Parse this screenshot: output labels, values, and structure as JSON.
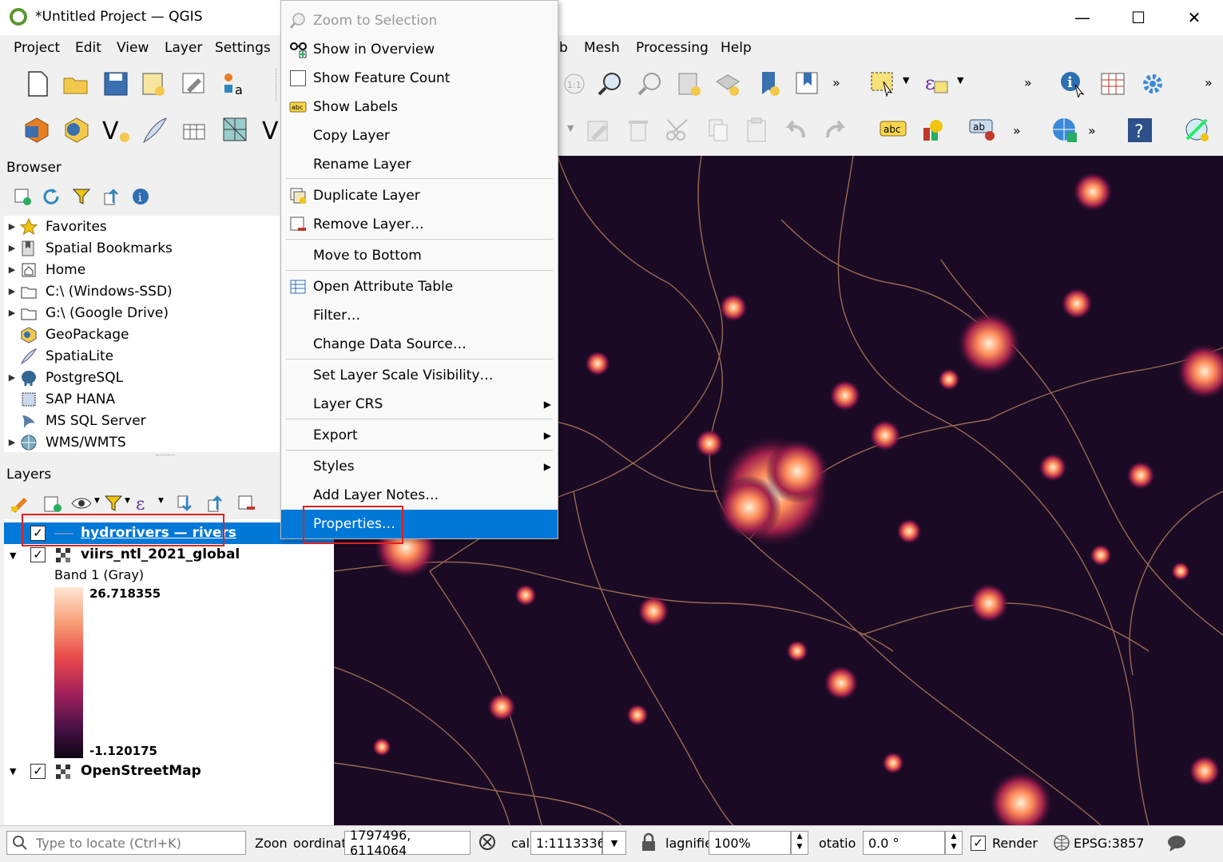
{
  "window": {
    "title": "*Untitled Project — QGIS",
    "minimize": "—",
    "maximize": "☐",
    "close": "✕"
  },
  "menubar": {
    "items": [
      "Project",
      "Edit",
      "View",
      "Layer",
      "Settings",
      "b",
      "Mesh",
      "Processing",
      "Help"
    ]
  },
  "browser": {
    "title": "Browser",
    "items": [
      {
        "label": "Favorites",
        "icon": "star-icon",
        "expandable": true
      },
      {
        "label": "Spatial Bookmarks",
        "icon": "bookmark-icon",
        "expandable": true
      },
      {
        "label": "Home",
        "icon": "home-icon",
        "expandable": true
      },
      {
        "label": "C:\\ (Windows-SSD)",
        "icon": "folder-icon",
        "expandable": true
      },
      {
        "label": "G:\\ (Google Drive)",
        "icon": "folder-icon",
        "expandable": true
      },
      {
        "label": "GeoPackage",
        "icon": "geopackage-icon",
        "expandable": false
      },
      {
        "label": "SpatiaLite",
        "icon": "feather-icon",
        "expandable": false
      },
      {
        "label": "PostgreSQL",
        "icon": "elephant-icon",
        "expandable": true
      },
      {
        "label": "SAP HANA",
        "icon": "hana-icon",
        "expandable": false
      },
      {
        "label": "MS SQL Server",
        "icon": "sqlserver-icon",
        "expandable": false
      },
      {
        "label": "WMS/WMTS",
        "icon": "globe-icon",
        "expandable": true
      }
    ]
  },
  "layers": {
    "title": "Layers",
    "items": [
      {
        "label": "hydrorivers — rivers",
        "checked": true,
        "selected": true
      },
      {
        "label": "viirs_ntl_2021_global",
        "checked": true,
        "selected": false
      },
      {
        "label": "OpenStreetMap",
        "checked": true,
        "selected": false
      }
    ],
    "band_label": "Band 1 (Gray)",
    "ramp_max": "26.718355",
    "ramp_min": "-1.120175"
  },
  "context_menu": {
    "items": [
      {
        "label": "Zoom to Selection",
        "disabled": true,
        "icon": "zoom-selection-icon"
      },
      {
        "label": "Show in Overview",
        "icon": "glasses-icon"
      },
      {
        "label": "Show Feature Count",
        "icon": "checkbox-icon"
      },
      {
        "label": "Show Labels",
        "icon": "label-abc-icon"
      },
      {
        "label": "Copy Layer"
      },
      {
        "label": "Rename Layer"
      },
      {
        "label": "Duplicate Layer",
        "icon": "duplicate-icon"
      },
      {
        "label": "Remove Layer…",
        "icon": "remove-layer-icon"
      },
      {
        "label": "Move to Bottom"
      },
      {
        "label": "Open Attribute Table",
        "icon": "table-icon"
      },
      {
        "label": "Filter…"
      },
      {
        "label": "Change Data Source…"
      },
      {
        "label": "Set Layer Scale Visibility…"
      },
      {
        "label": "Layer CRS",
        "submenu": true
      },
      {
        "label": "Export",
        "submenu": true
      },
      {
        "label": "Styles",
        "submenu": true
      },
      {
        "label": "Add Layer Notes…"
      },
      {
        "label": "Properties…",
        "highlighted": true
      }
    ]
  },
  "statusbar": {
    "locator_placeholder": "Type to locate (Ctrl+K)",
    "zoom_label": "Zoon",
    "coordinate_label": "oordinat",
    "coordinate_value": "1797496, 6114064",
    "scale_label": "cal",
    "scale_value": "1:1113336",
    "magnifier_label": "lagnifie",
    "magnifier_value": "100%",
    "rotation_label": "otatio",
    "rotation_value": "0.0 °",
    "render_label": "Render",
    "crs": "EPSG:3857"
  },
  "colors": {
    "accent": "#0078d7",
    "highlight_box": "#e02020",
    "map_bg": "#1a0a24",
    "river": "#b07a5a"
  }
}
